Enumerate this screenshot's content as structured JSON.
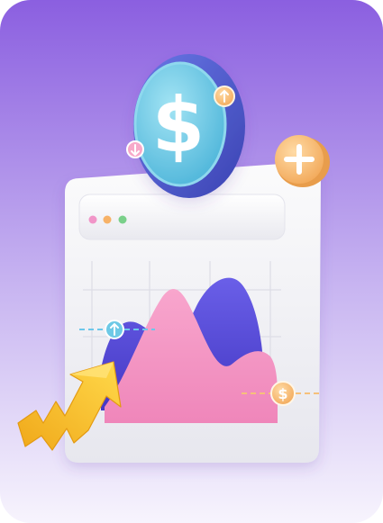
{
  "illustration": {
    "subject": "finance-growth-3d-illustration",
    "colors": {
      "bg_top": "#8b5fe0",
      "bg_bottom": "#f7f4fd",
      "coin_face": "#6ec9e6",
      "coin_rim": "#4b5bd0",
      "chart_pink": "#f38fbe",
      "chart_purple": "#5448d2",
      "arrow_yellow": "#f5c32a",
      "badge_orange": "#f6c07a",
      "window_body": "#f2f2f4"
    },
    "icons": {
      "coin": "dollar-coin-icon",
      "plus": "plus-icon",
      "up": "arrow-up-icon",
      "down": "arrow-down-icon",
      "dollar_badge": "dollar-badge-icon",
      "trend": "trend-up-arrow-icon"
    },
    "chart": {
      "type": "area",
      "series": 2
    }
  }
}
